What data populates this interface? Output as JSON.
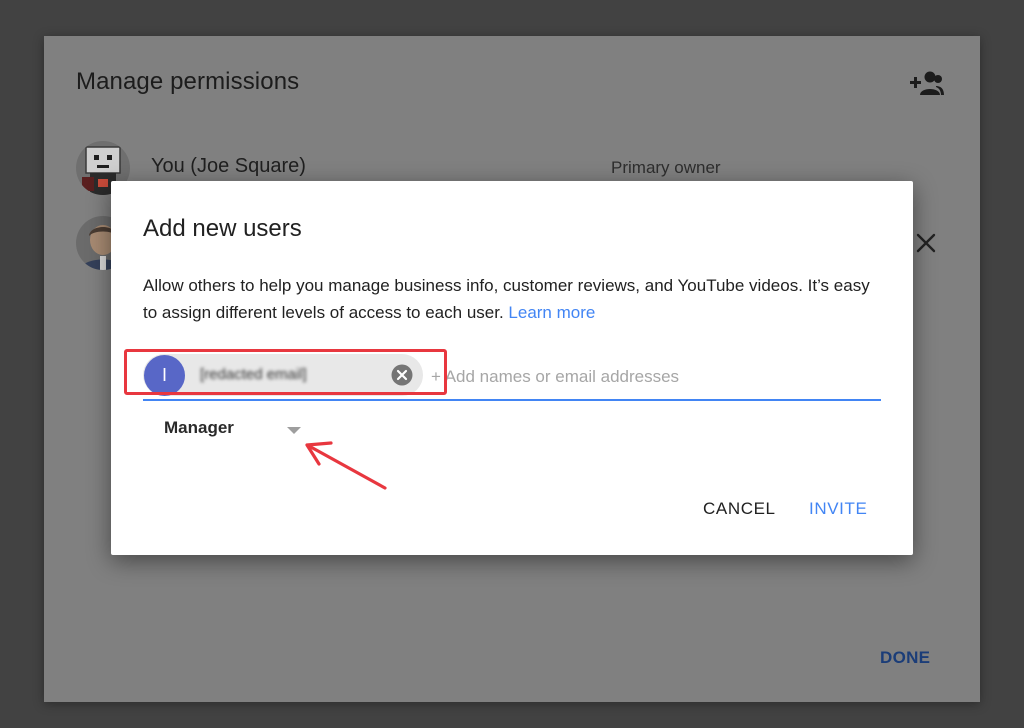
{
  "background_dialog": {
    "title": "Manage permissions",
    "add_user_icon": "person-add-icon",
    "users": [
      {
        "name": "You (Joe Square)",
        "role": "Primary owner",
        "avatar": "pixel-character-avatar"
      },
      {
        "avatar": "man-photo-avatar"
      }
    ],
    "remove_icon": "close-icon",
    "done_label": "DONE"
  },
  "add_users_dialog": {
    "title": "Add new users",
    "description": "Allow others to help you manage business info, customer reviews, and YouTube videos. It’s easy to assign different levels of access to each user.",
    "learn_more": "Learn more",
    "recipient_chip": {
      "initial": "I",
      "email": "[redacted email]",
      "remove_icon": "cancel-circle-icon"
    },
    "input_placeholder": "+ Add names or email addresses",
    "role": "Manager",
    "cancel_label": "CANCEL",
    "invite_label": "INVITE"
  },
  "annotation": {
    "highlight_color": "#e8373f",
    "arrow_color": "#e8373f"
  },
  "colors": {
    "accent": "#4285f4",
    "chip_avatar": "#5867c7"
  }
}
